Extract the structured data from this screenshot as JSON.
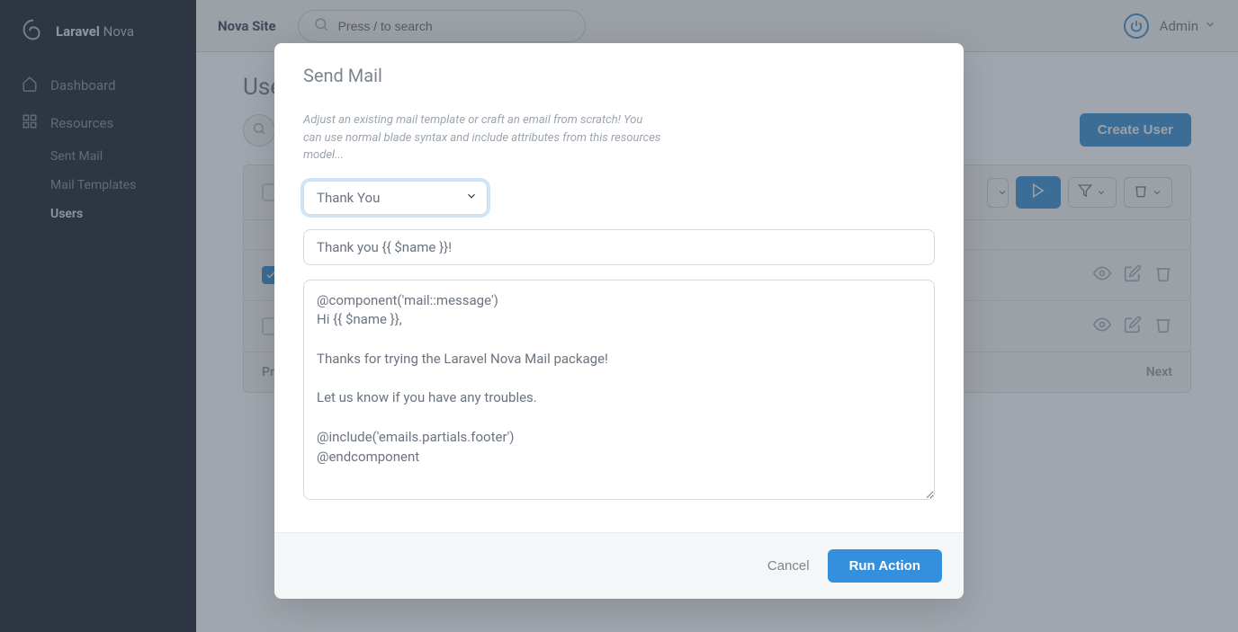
{
  "brand": {
    "name_strong": "Laravel",
    "name_light": "Nova"
  },
  "header": {
    "site_title": "Nova Site",
    "search_placeholder": "Press / to search",
    "user_label": "Admin"
  },
  "sidebar": {
    "dashboard": "Dashboard",
    "resources": "Resources",
    "items": [
      {
        "label": "Sent Mail"
      },
      {
        "label": "Mail Templates"
      },
      {
        "label": "Users"
      }
    ]
  },
  "page": {
    "title": "Users",
    "create_button": "Create User"
  },
  "pagination": {
    "prev": "Previous",
    "next": "Next"
  },
  "modal": {
    "title": "Send Mail",
    "description": "Adjust an existing mail template or craft an email from scratch! You can use normal blade syntax and include attributes from this resources model...",
    "select_value": "Thank You",
    "subject_value": "Thank you {{ $name }}!",
    "body_value": "@component('mail::message')\nHi {{ $name }},\n\nThanks for trying the Laravel Nova Mail package!\n\nLet us know if you have any troubles.\n\n@include('emails.partials.footer')\n@endcomponent",
    "cancel_label": "Cancel",
    "run_label": "Run Action"
  }
}
